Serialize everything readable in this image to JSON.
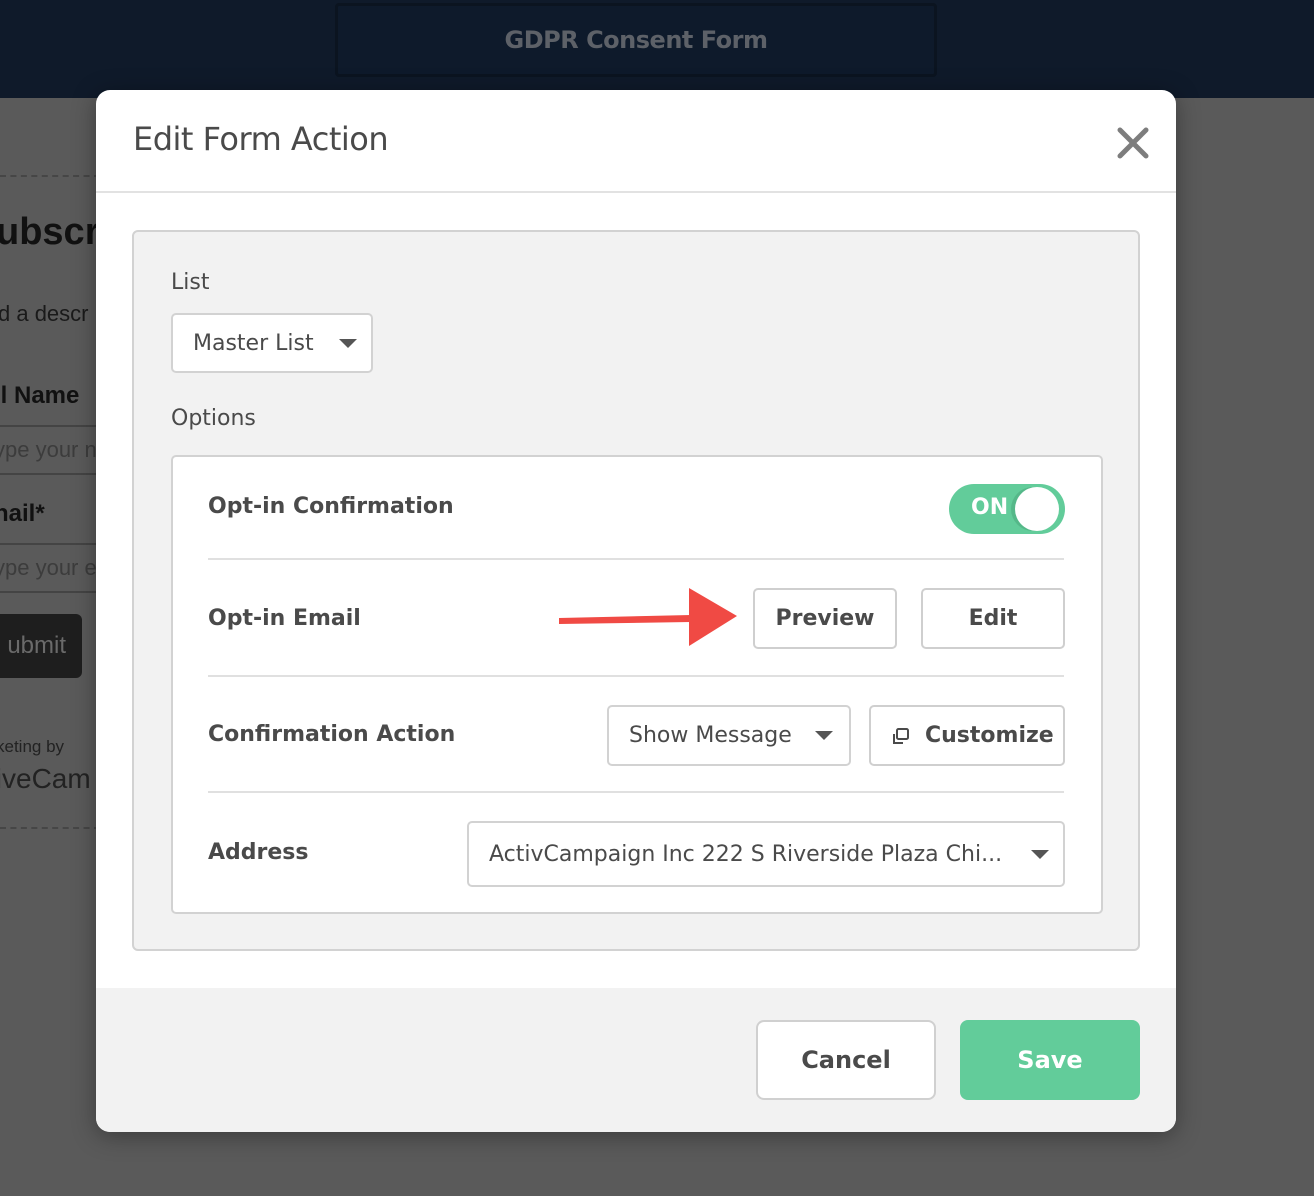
{
  "topbar": {
    "title": "GDPR Consent Form"
  },
  "background_form": {
    "heading": "ubscr",
    "description": "d a descr",
    "full_name_label": "ll Name",
    "full_name_placeholder": "ype your n",
    "email_label": "nail*",
    "email_placeholder": "ype your e",
    "submit_label": "ubmit",
    "marketing_text": "keting by",
    "brand_text": "tiveCam"
  },
  "modal": {
    "title": "Edit Form Action",
    "close_icon": "close-icon",
    "list": {
      "label": "List",
      "selected": "Master List"
    },
    "options": {
      "label": "Options",
      "opt_in_confirmation": {
        "label": "Opt-in Confirmation",
        "toggle_state": "ON",
        "enabled": true
      },
      "opt_in_email": {
        "label": "Opt-in Email",
        "preview_label": "Preview",
        "edit_label": "Edit"
      },
      "confirmation_action": {
        "label": "Confirmation Action",
        "selected": "Show Message",
        "customize_label": "Customize",
        "customize_icon": "external-window-icon"
      },
      "address": {
        "label": "Address",
        "selected": "ActivCampaign Inc 222 S Riverside Plaza Chi..."
      }
    },
    "footer": {
      "cancel_label": "Cancel",
      "save_label": "Save"
    }
  },
  "annotation": {
    "type": "arrow",
    "color": "#f04a44",
    "points_to": "Preview"
  },
  "colors": {
    "accent_green": "#62cc9a",
    "topbar": "#0f1a2a",
    "overlay": "#5a5a5a"
  }
}
